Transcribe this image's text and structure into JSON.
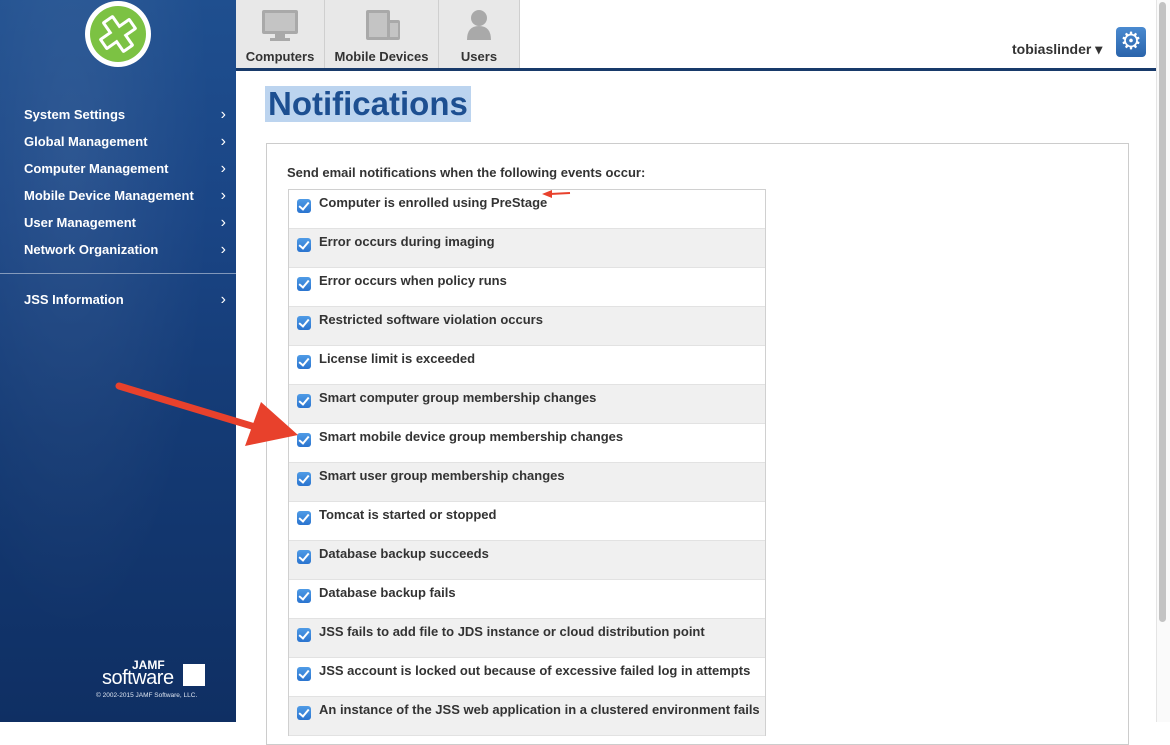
{
  "sidebar": {
    "nav": [
      {
        "label": "System Settings"
      },
      {
        "label": "Global Management"
      },
      {
        "label": "Computer Management"
      },
      {
        "label": "Mobile Device Management"
      },
      {
        "label": "User Management"
      },
      {
        "label": "Network Organization"
      }
    ],
    "nav_secondary": [
      {
        "label": "JSS Information"
      }
    ],
    "brand": {
      "jamf": "JAMF",
      "software": "software",
      "copyright": "© 2002-2015 JAMF Software, LLC."
    }
  },
  "tabs": [
    {
      "label": "Computers",
      "icon": "monitor-icon"
    },
    {
      "label": "Mobile Devices",
      "icon": "mobile-devices-icon"
    },
    {
      "label": "Users",
      "icon": "user-icon"
    }
  ],
  "user": {
    "name": "tobiaslinder ▾"
  },
  "page": {
    "title": "Notifications",
    "prompt": "Send email notifications when the following events occur:"
  },
  "notifications": [
    {
      "label": "Computer is enrolled using PreStage",
      "checked": true
    },
    {
      "label": "Error occurs during imaging",
      "checked": true
    },
    {
      "label": "Error occurs when policy runs",
      "checked": true
    },
    {
      "label": "Restricted software violation occurs",
      "checked": true
    },
    {
      "label": "License limit is exceeded",
      "checked": true
    },
    {
      "label": "Smart computer group membership changes",
      "checked": true
    },
    {
      "label": "Smart mobile device group membership changes",
      "checked": true
    },
    {
      "label": "Smart user group membership changes",
      "checked": true
    },
    {
      "label": "Tomcat is started or stopped",
      "checked": true
    },
    {
      "label": "Database backup succeeds",
      "checked": true
    },
    {
      "label": "Database backup fails",
      "checked": true
    },
    {
      "label": "JSS fails to add file to JDS instance or cloud distribution point",
      "checked": true
    },
    {
      "label": "JSS account is locked out because of excessive failed log in attempts",
      "checked": true
    },
    {
      "label": "An instance of the JSS web application in a clustered environment fails",
      "checked": true
    }
  ],
  "colors": {
    "accent": "#1d4f91",
    "checkbox": "#2a74cf",
    "annotation": "#e8412c"
  }
}
